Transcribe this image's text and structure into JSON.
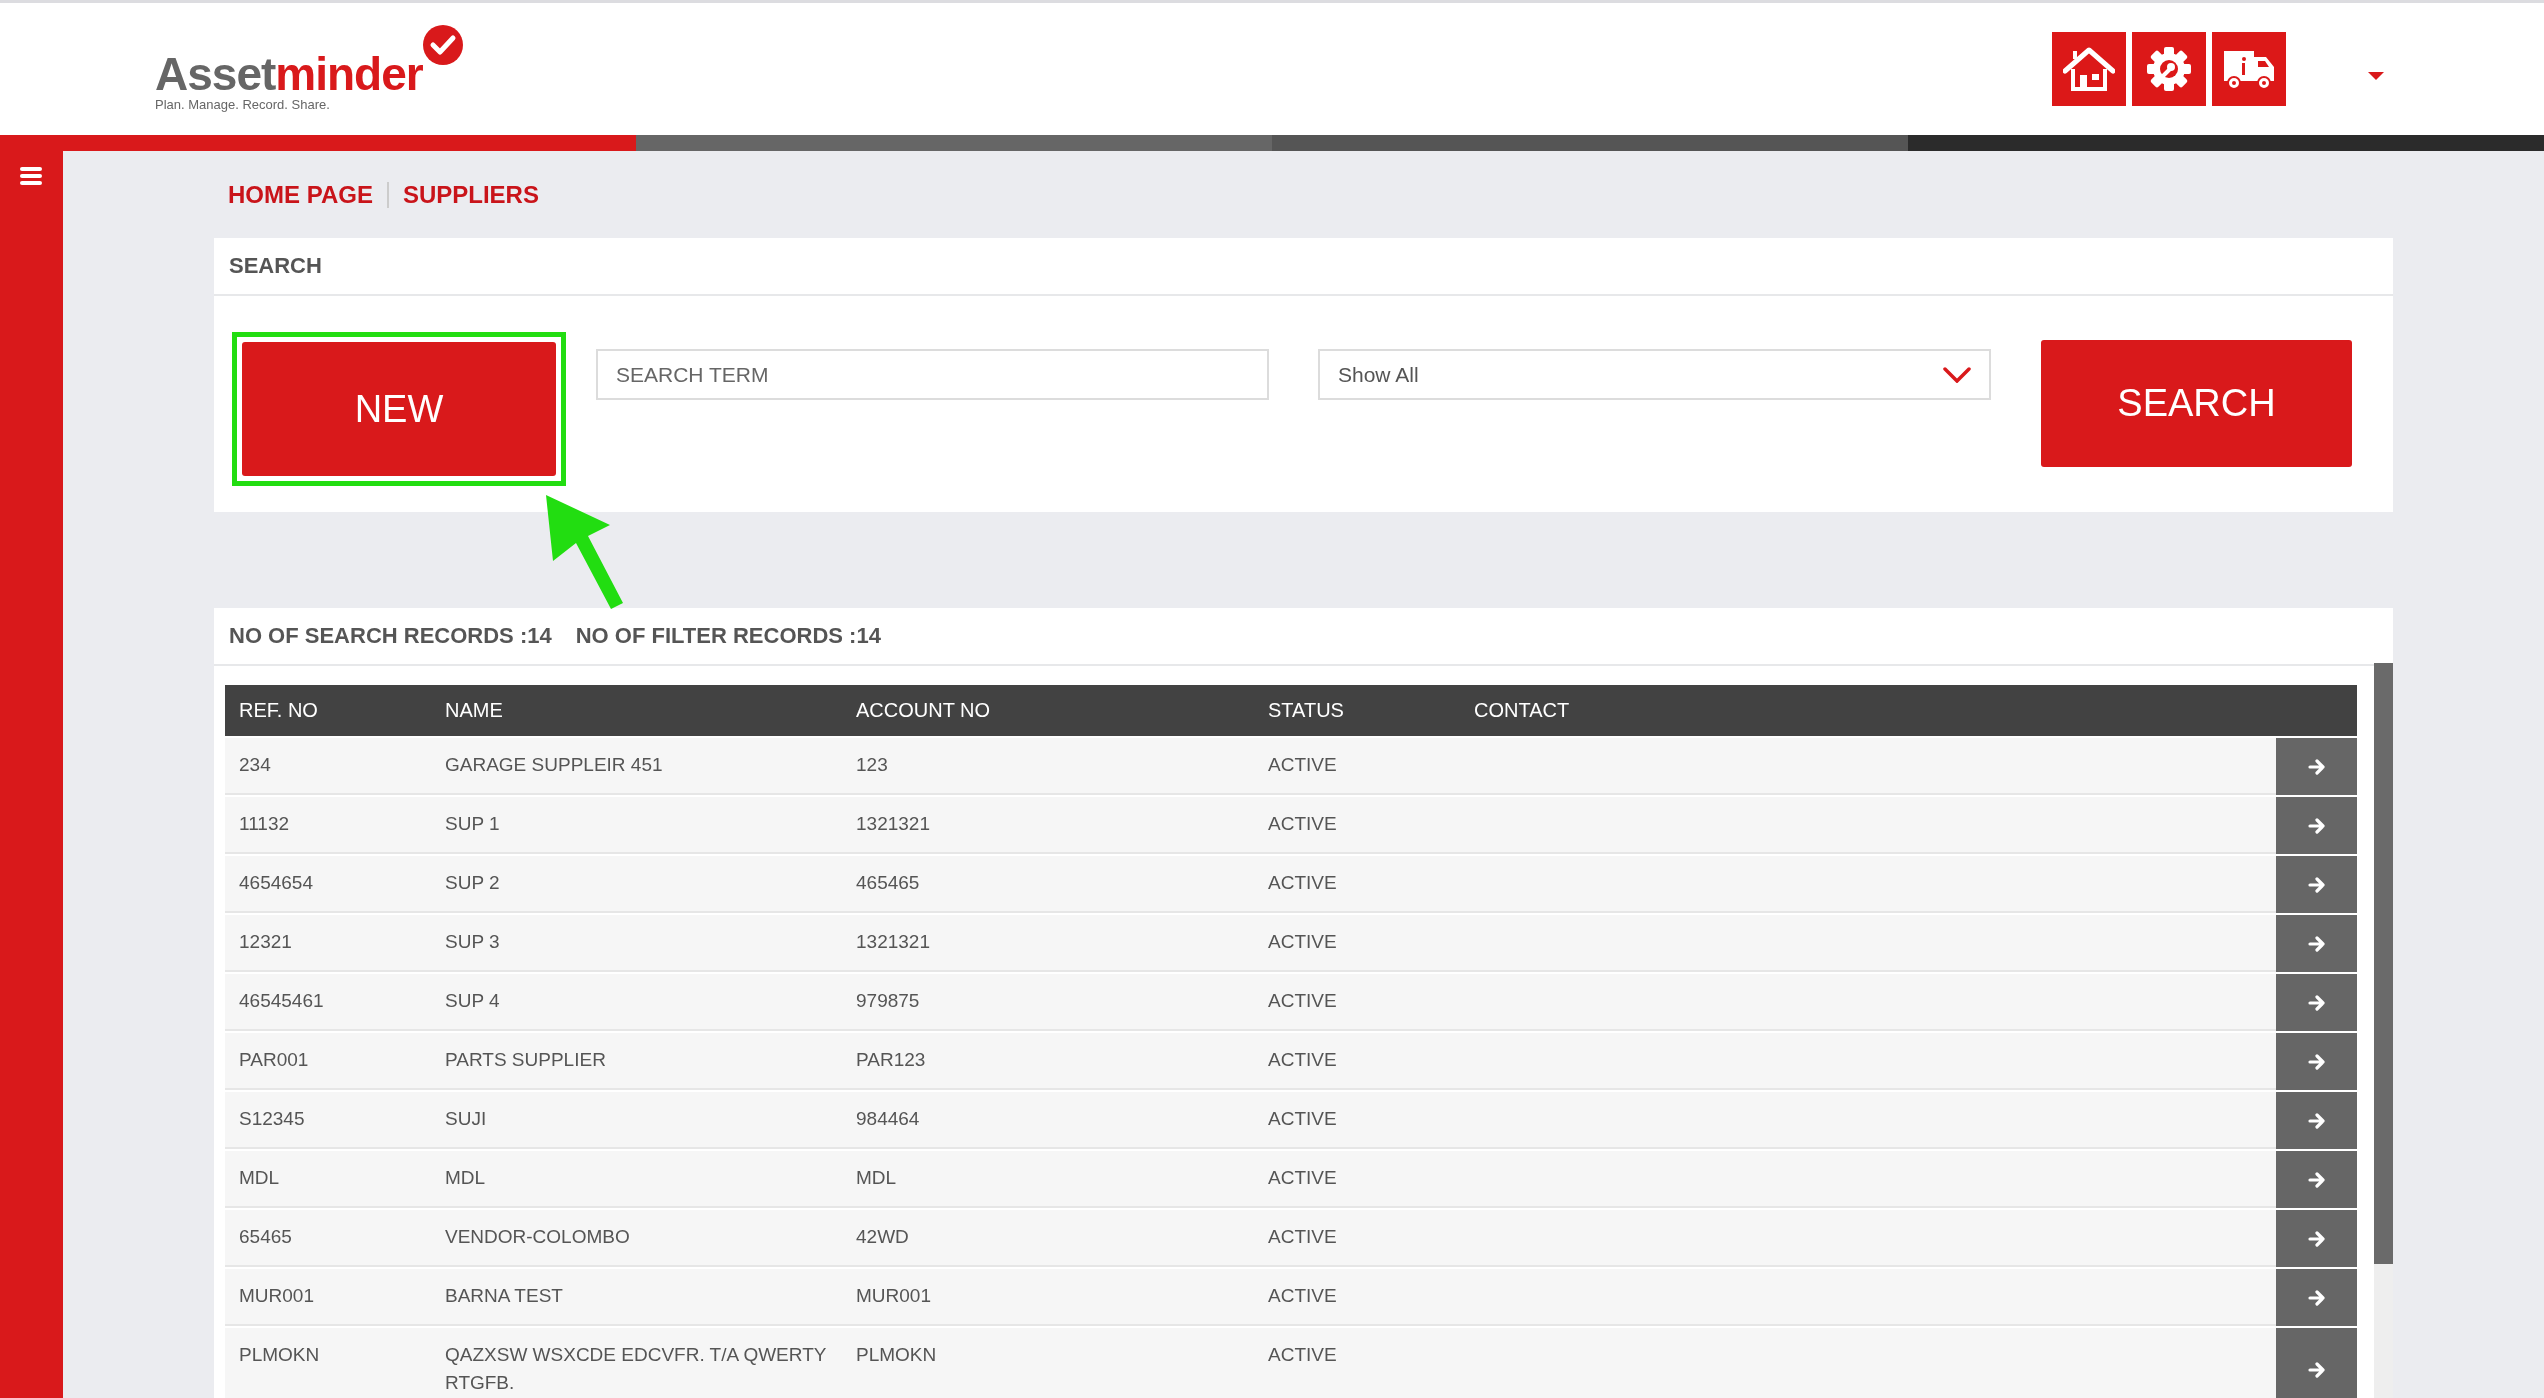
{
  "logo": {
    "name_start": "Asset",
    "name_end": "minder",
    "tagline": "Plan. Manage. Record. Share."
  },
  "breadcrumb": [
    {
      "label": "HOME PAGE"
    },
    {
      "label": "SUPPLIERS"
    }
  ],
  "search_panel": {
    "title": "SEARCH",
    "new_button": "NEW",
    "search_field": {
      "placeholder": "SEARCH TERM"
    },
    "filter": {
      "value": "Show All"
    },
    "search_button": "SEARCH"
  },
  "results": {
    "search_count": "NO OF SEARCH RECORDS :14",
    "filter_count": "NO OF FILTER RECORDS :14",
    "columns": [
      "REF. NO",
      "NAME",
      "ACCOUNT NO",
      "STATUS",
      "CONTACT"
    ],
    "rows": [
      [
        "234",
        "GARAGE SUPPLEIR 451",
        "123",
        "ACTIVE"
      ],
      [
        "11132",
        "SUP 1",
        "1321321",
        "ACTIVE"
      ],
      [
        "4654654",
        "SUP 2",
        "465465",
        "ACTIVE"
      ],
      [
        "12321",
        "SUP 3",
        "1321321",
        "ACTIVE"
      ],
      [
        "46545461",
        "SUP 4",
        "979875",
        "ACTIVE"
      ],
      [
        "PAR001",
        "PARTS SUPPLIER",
        "PAR123",
        "ACTIVE"
      ],
      [
        "S12345",
        "SUJI",
        "984464",
        "ACTIVE"
      ],
      [
        "MDL",
        "MDL",
        "MDL",
        "ACTIVE"
      ],
      [
        "65465",
        "VENDOR-COLOMBO",
        "42WD",
        "ACTIVE"
      ],
      [
        "MUR001",
        "BARNA TEST",
        "MUR001",
        "ACTIVE"
      ],
      [
        "PLMOKN",
        "QAZXSW WSXCDE EDCVFR. T/A QWERTY RTGFB.",
        "PLMOKN",
        "ACTIVE"
      ]
    ]
  }
}
